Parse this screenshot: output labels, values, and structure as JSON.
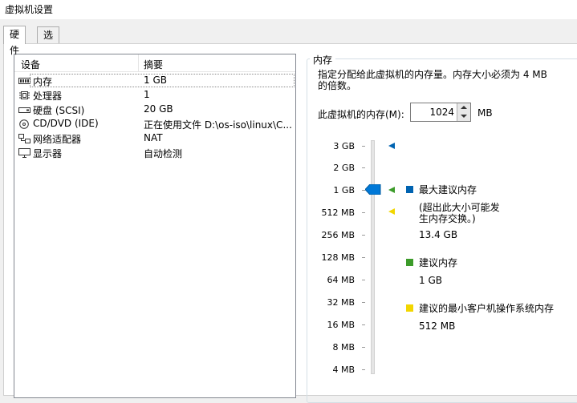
{
  "window": {
    "title": "虚拟机设置"
  },
  "tabs": [
    {
      "label": "硬件",
      "active": true
    },
    {
      "label": "选项",
      "active": false
    }
  ],
  "device_list": {
    "headers": {
      "device": "设备",
      "summary": "摘要"
    },
    "rows": [
      {
        "name": "内存",
        "summary": "1 GB",
        "icon": "memory-icon",
        "selected": true
      },
      {
        "name": "处理器",
        "summary": "1",
        "icon": "cpu-icon",
        "selected": false
      },
      {
        "name": "硬盘 (SCSI)",
        "summary": "20 GB",
        "icon": "hard-disk-icon",
        "selected": false
      },
      {
        "name": "CD/DVD (IDE)",
        "summary": "正在使用文件 D:\\os-iso\\linux\\C...",
        "icon": "cd-dvd-icon",
        "selected": false
      },
      {
        "name": "网络适配器",
        "summary": "NAT",
        "icon": "network-adapter-icon",
        "selected": false
      },
      {
        "name": "显示器",
        "summary": "自动检测",
        "icon": "display-icon",
        "selected": false
      }
    ]
  },
  "memory": {
    "group_title": "内存",
    "description": "指定分配给此虚拟机的内存量。内存大小必须为 4 MB 的倍数。",
    "field_label": "此虚拟机的内存(M):",
    "value": "1024",
    "unit": "MB",
    "scale": [
      "3 GB",
      "2 GB",
      "1 GB",
      "512 MB",
      "256 MB",
      "128 MB",
      "64 MB",
      "32 MB",
      "16 MB",
      "8 MB",
      "4 MB"
    ],
    "legend": {
      "max": {
        "title": "最大建议内存",
        "note": "(超出此大小可能发生内存交换。)",
        "value": "13.4 GB",
        "color": "#0063b1"
      },
      "recommended": {
        "title": "建议内存",
        "value": "1 GB",
        "color": "#3c9b2a"
      },
      "min": {
        "title": "建议的最小客户机操作系统内存",
        "value": "512 MB",
        "color": "#f2d600"
      }
    },
    "slider_color": "#0078d7"
  }
}
